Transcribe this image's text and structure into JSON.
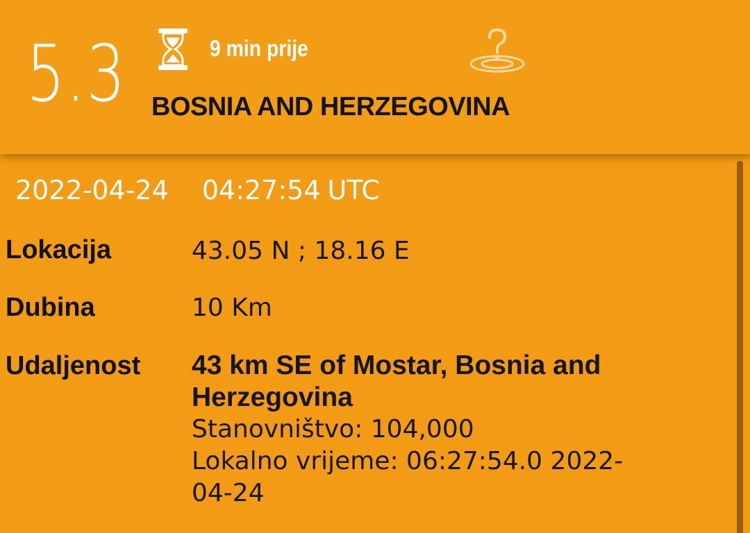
{
  "event": {
    "magnitude": "5.3",
    "time_ago": "9 min prije",
    "region": "BOSNIA AND HERZEGOVINA",
    "date": "2022-04-24",
    "time": "04:27:54",
    "timezone": "UTC"
  },
  "details": {
    "location_label": "Lokacija",
    "location_value": "43.05 N ; 18.16 E",
    "depth_label": "Dubina",
    "depth_value": "10 Km",
    "distance_label": "Udaljenost",
    "distance_value": "43 km SE of Mostar, Bosnia and Herzegovina",
    "population": "Stanovništvo: 104,000",
    "local_time_line1": "Lokalno vrijeme: 06:27:54.0 2022-",
    "local_time_line2": "04-24"
  },
  "icons": {
    "time": "hourglass-icon",
    "felt_report": "felt-question-icon"
  },
  "colors": {
    "background": "#f39b14",
    "header_text": "#ffffff",
    "body_text": "#111111",
    "scrollbar": "#9a5c08"
  }
}
